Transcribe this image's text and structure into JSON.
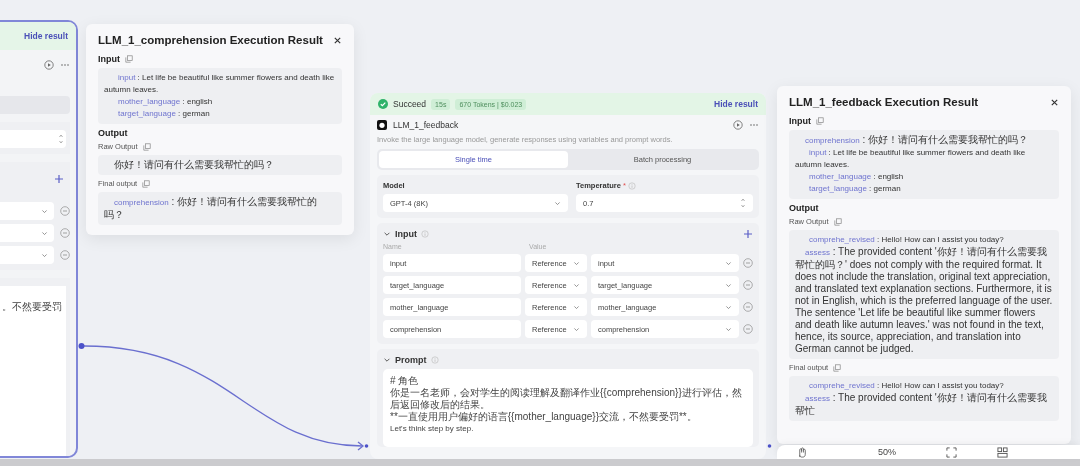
{
  "left_node": {
    "hide_result": "Hide result",
    "variable_rows": [
      {
        "kind": "reference"
      },
      {
        "kind": "reference"
      },
      {
        "kind": "reference"
      }
    ],
    "prompt_text": "。不然要受罚"
  },
  "comprehension_result": {
    "title": "LLM_1_comprehension Execution Result",
    "input_label": "Input",
    "input": [
      {
        "key": "input",
        "value": " : Let life be beautiful like summer flowers and death like autumn leaves."
      },
      {
        "key": "mother_language",
        "value": " : english"
      },
      {
        "key": "target_language",
        "value": " : german"
      }
    ],
    "output_label": "Output",
    "raw_output_label": "Raw Output",
    "raw_output": [
      {
        "value": "你好！请问有什么需要我帮忙的吗？"
      }
    ],
    "final_output_label": "Final output",
    "final_output": [
      {
        "key": "comprehension",
        "value": " : 你好！请问有什么需要我帮忙的吗？"
      }
    ]
  },
  "feedback_node": {
    "status": "Succeed",
    "duration": "15s",
    "usage": "670 Tokens | $0.023",
    "hide_result": "Hide result",
    "name": "LLM_1_feedback",
    "description": "Invoke the large language model, generate responses using variables and prompt words.",
    "modes": [
      {
        "label": "Single time",
        "selected": true
      },
      {
        "label": "Batch processing",
        "selected": false
      }
    ],
    "model_label": "Model",
    "model": "GPT-4 (8K)",
    "temperature_label": "Temperature",
    "required_mark": "*",
    "temperature": "0.7",
    "input_section": {
      "title": "Input",
      "expanded": true,
      "columns": [
        "Name",
        "Value"
      ],
      "rows": [
        {
          "name": "input",
          "source": "Reference",
          "value": "input"
        },
        {
          "name": "target_language",
          "source": "Reference",
          "value": "target_language"
        },
        {
          "name": "mother_language",
          "source": "Reference",
          "value": "mother_language"
        },
        {
          "name": "comprehension",
          "source": "Reference",
          "value": "comprehension"
        }
      ]
    },
    "prompt_section": {
      "title": "Prompt",
      "expanded": true,
      "lines": [
        "# 角色",
        "你是一名老师，会对学生的阅读理解及翻译作业{{comprehension}}进行评估，然后返回修改后的结果。",
        "**一直使用用户偏好的语言{{mother_language}}交流，不然要受罚**。",
        "Let's think step by step."
      ]
    }
  },
  "feedback_result": {
    "title": "LLM_1_feedback Execution Result",
    "input_label": "Input",
    "input": [
      {
        "key": "comprehension",
        "value": " : 你好！请问有什么需要我帮忙的吗？"
      },
      {
        "key": "input",
        "value": " : Let life be beautiful like summer flowers and death like autumn leaves."
      },
      {
        "key": "mother_language",
        "value": " : english"
      },
      {
        "key": "target_language",
        "value": " : german"
      }
    ],
    "output_label": "Output",
    "raw_output_label": "Raw Output",
    "raw_output": [
      {
        "key": "comprehe_revised",
        "value": " : Hello! How can I assist you today?"
      },
      {
        "key": "assess",
        "value": " : The provided content '你好！请问有什么需要我帮忙的吗？' does not comply with the required format. It does not include the translation, original text appreciation, and translated text explanation sections. Furthermore, it is not in English, which is the preferred language of the user. The sentence 'Let life be beautiful like summer flowers and death like autumn leaves.' was not found in the text, hence, its source, appreciation, and translation into German cannot be judged."
      }
    ],
    "final_output_label": "Final output",
    "final_output": [
      {
        "key": "comprehe_revised",
        "value": " : Hello! How can I assist you today?"
      },
      {
        "key": "assess",
        "value": " : The provided content '你好！请问有什么需要我帮忙"
      }
    ]
  },
  "toolbar": {
    "zoom": "50%"
  }
}
